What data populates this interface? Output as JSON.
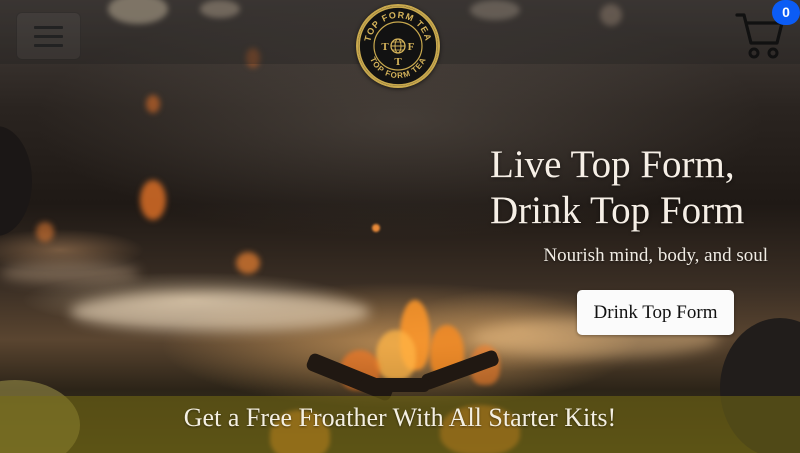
{
  "header": {
    "menu_icon": "hamburger-menu-icon",
    "logo": {
      "text_ring": "TOP FORM TEA",
      "letters": [
        "T",
        "F",
        "T"
      ],
      "colors": {
        "gold": "#c9a94e",
        "dark": "#111111"
      }
    },
    "cart": {
      "icon": "shopping-cart-icon",
      "count": "0",
      "badge_color": "#0b5cf5"
    }
  },
  "hero": {
    "title_line1": "Live Top Form,",
    "title_line2": "Drink Top Form",
    "subtitle": "Nourish mind, body, and soul",
    "cta_label": "Drink Top Form"
  },
  "promo": {
    "text": "Get a Free Froather With All Starter Kits!"
  }
}
